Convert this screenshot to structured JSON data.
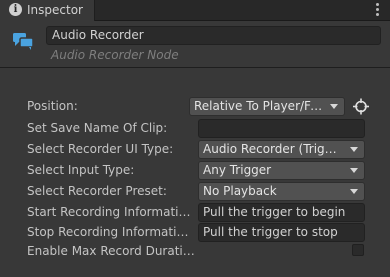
{
  "tab": {
    "icon": "info-icon",
    "title": "Inspector",
    "menu_icon": "kebab-menu-icon"
  },
  "header": {
    "icon": "speech-bubbles-icon",
    "name_value": "Audio Recorder",
    "subtitle": "Audio Recorder Node"
  },
  "properties": {
    "position": {
      "label": "Position:",
      "value": "Relative To Player/Fro...",
      "target_icon": "crosshair-icon"
    },
    "save_name": {
      "label": "Set Save Name Of Clip:",
      "value": ""
    },
    "ui_type": {
      "label": "Select Recorder UI Type:",
      "value": "Audio Recorder (Trigger..."
    },
    "input_type": {
      "label": "Select Input Type:",
      "value": "Any Trigger"
    },
    "preset": {
      "label": "Select Recorder Preset:",
      "value": "No Playback"
    },
    "start_info": {
      "label": "Start Recording Information...",
      "value": "Pull the trigger to begin"
    },
    "stop_info": {
      "label": "Stop Recording Information...",
      "value": "Pull the trigger to stop"
    },
    "max_duration": {
      "label": "Enable Max Record Duration",
      "checked": false
    }
  },
  "colors": {
    "panel_bg": "#383838",
    "tab_bar_bg": "#282828",
    "icon_blue": "#4aa3e0",
    "field_bg": "#2a2a2a",
    "dropdown_bg": "#515151"
  }
}
